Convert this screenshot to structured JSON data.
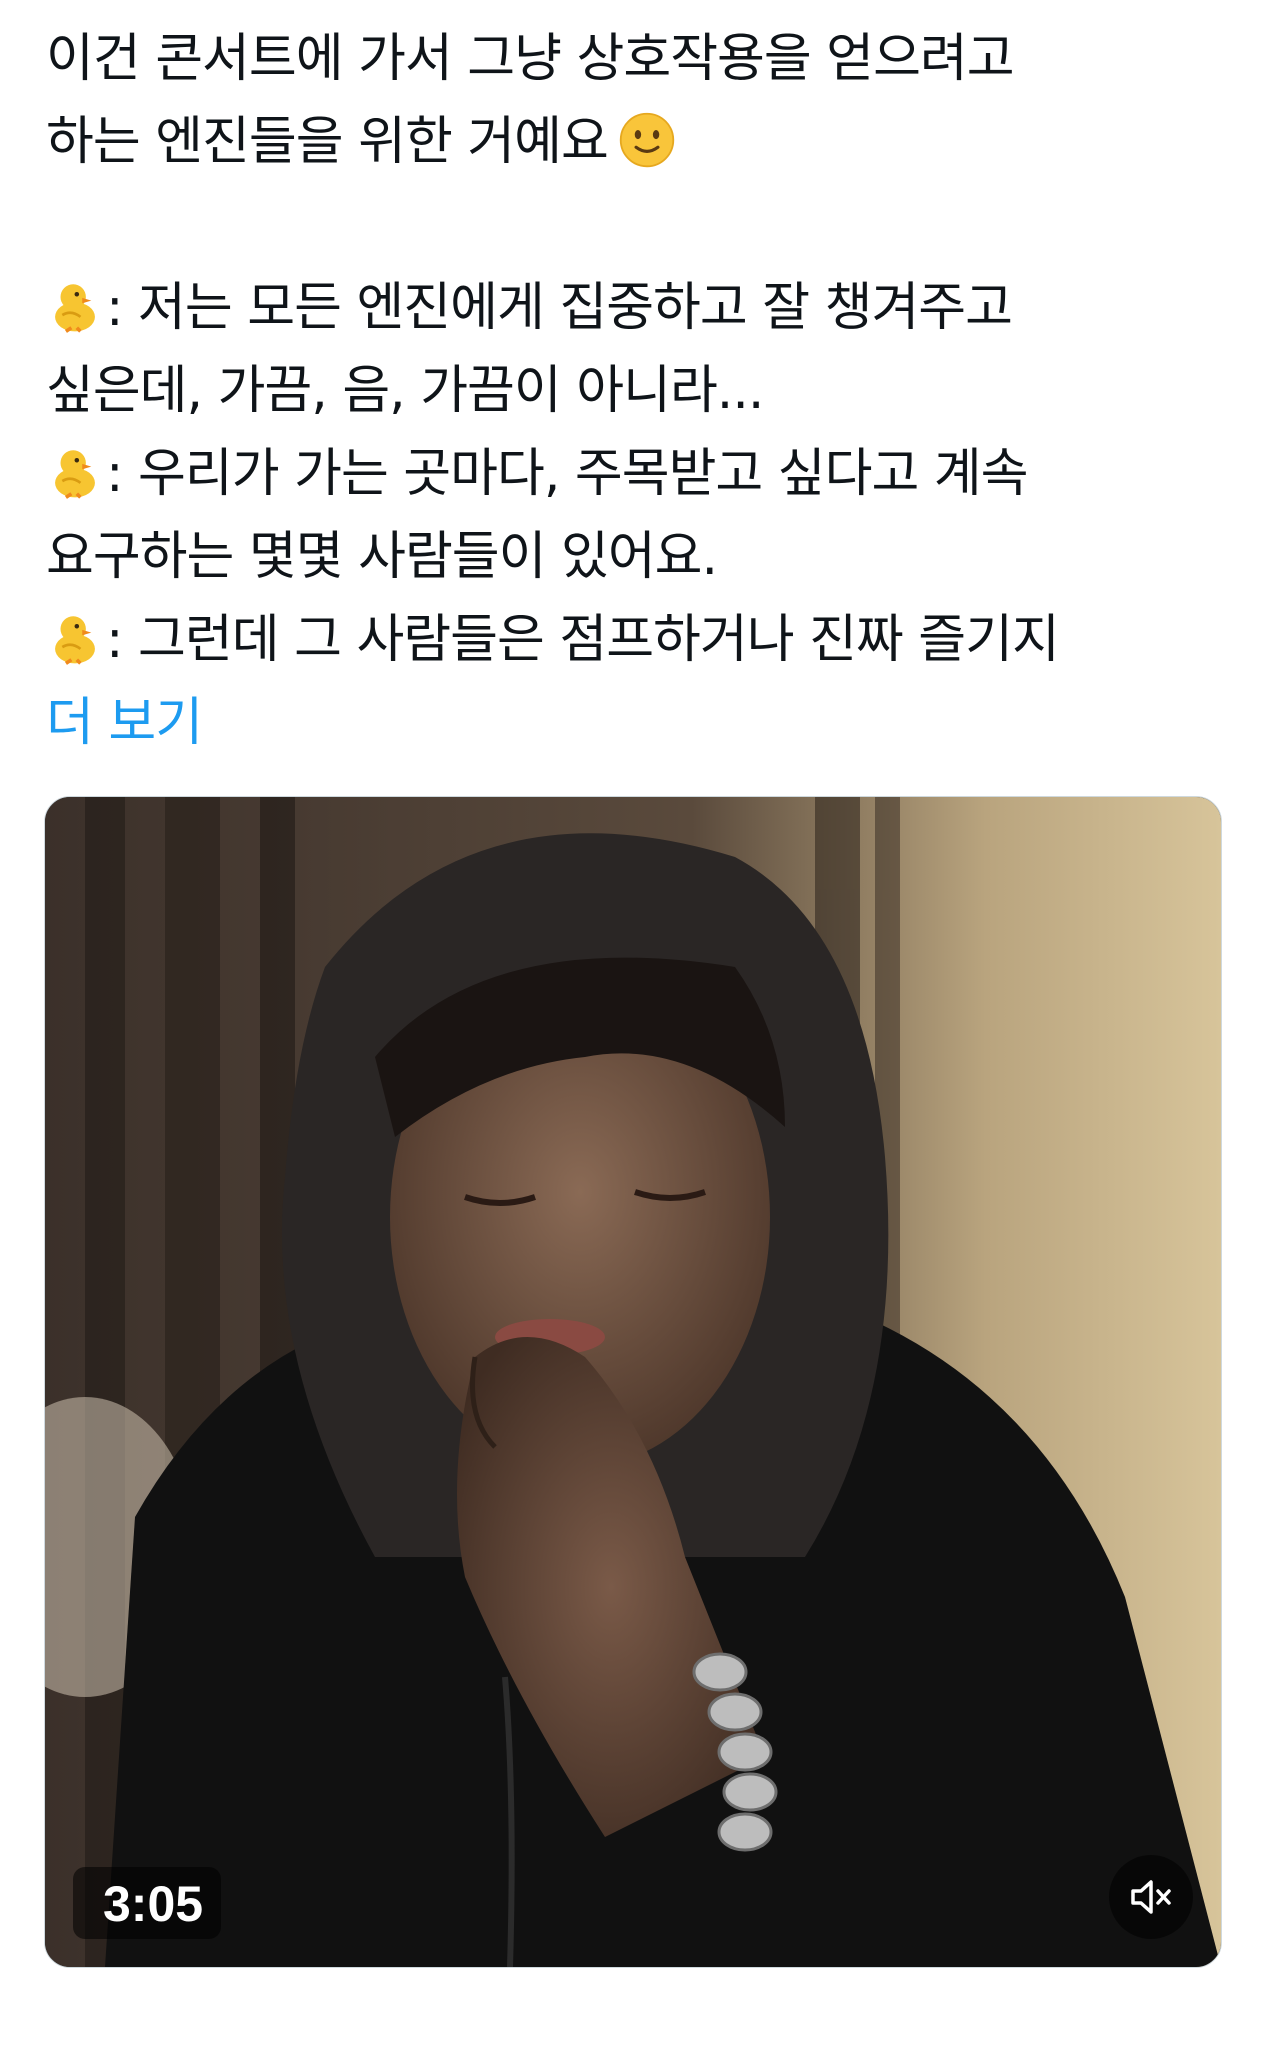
{
  "tweet": {
    "line1": "이건 콘서트에 가서 그냥 상호작용을 얻으려고",
    "line2": "하는 엔진들을 위한 거예요",
    "line2_emoji": "slightly-smiling-face-icon",
    "line3": ": 저는 모든 엔진에게 집중하고 잘 챙겨주고",
    "line4": "싶은데, 가끔, 음, 가끔이 아니라...",
    "line5": ": 우리가 가는 곳마다, 주목받고 싶다고 계속",
    "line6": "요구하는 몇몇 사람들이 있어요.",
    "line7": ": 그런데 그 사람들은 점프하거나 진짜 즐기지",
    "quote_emoji": "baby-chick-icon",
    "show_more": "더 보기"
  },
  "video": {
    "duration": "3:05",
    "mute_icon": "speaker-muted-icon"
  },
  "colors": {
    "text": "#0f1419",
    "link": "#1d9bf0",
    "overlay": "rgba(0,0,0,0.55)"
  }
}
